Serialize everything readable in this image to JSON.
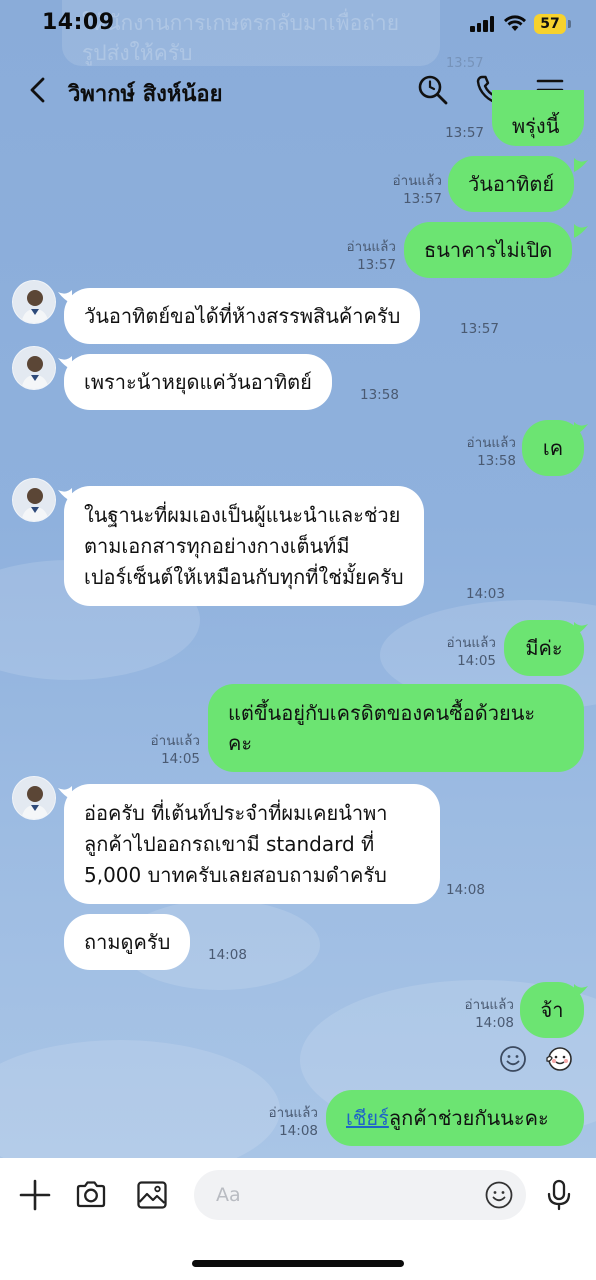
{
  "status_bar": {
    "time": "14:09",
    "battery": "57"
  },
  "header": {
    "contact_name": "วิพากษ์ สิงห์น้อย"
  },
  "ghost_message": {
    "text": "ให้นักงานการเกษตรกลับมาเพื่อถ่ายรูปส่งให้ครับ",
    "time": "13:57"
  },
  "messages": [
    {
      "side": "out",
      "text": "พรุ่งนี้",
      "read": "",
      "time": "13:57"
    },
    {
      "side": "out",
      "text": "วันอาทิตย์",
      "read": "อ่านแล้ว",
      "time": "13:57"
    },
    {
      "side": "out",
      "text": "ธนาคารไม่เปิด",
      "read": "อ่านแล้ว",
      "time": "13:57"
    },
    {
      "side": "in",
      "text": "วันอาทิตย์ขอได้ที่ห้างสรรพสินค้าครับ",
      "time": "13:57"
    },
    {
      "side": "in",
      "text": "เพราะน้าหยุดแค่วันอาทิตย์",
      "time": "13:58"
    },
    {
      "side": "out",
      "text": "เค",
      "read": "อ่านแล้ว",
      "time": "13:58"
    },
    {
      "side": "in",
      "lines": [
        "ในฐานะที่ผมเองเป็นผู้แนะนำและช่วย",
        "ตามเอกสารทุกอย่างกางเต็นท์มี",
        "เปอร์เซ็นต์ให้เหมือนกับทุกที่ใช่มั้ยครับ"
      ],
      "time": "14:03"
    },
    {
      "side": "out",
      "text": "มีค่ะ",
      "read": "อ่านแล้ว",
      "time": "14:05"
    },
    {
      "side": "out",
      "lines": [
        "แต่ขึ้นอยู่กับเครดิตของคนซื้อด้วยนะ",
        "คะ"
      ],
      "read": "อ่านแล้ว",
      "time": "14:05"
    },
    {
      "side": "in",
      "lines": [
        "อ่อครับ ที่เต้นท์ประจำที่ผมเคยนำพา",
        "ลูกค้าไปออกรถเขามี standard ที่",
        "5,000 บาทครับเลยสอบถามดำครับ"
      ],
      "time": "14:08"
    },
    {
      "side": "in",
      "text": "ถามดูครับ",
      "time": "14:08"
    },
    {
      "side": "out",
      "text": "จ้า",
      "read": "อ่านแล้ว",
      "time": "14:08"
    },
    {
      "side": "out",
      "link": "เชียร์",
      "rest": "ลูกค้าช่วยกันนะคะ",
      "read": "อ่านแล้ว",
      "time": "14:08"
    }
  ],
  "reactions": [
    {
      "icon": "smiley-reaction-icon"
    },
    {
      "icon": "cheek-pinch-sticker-icon"
    }
  ],
  "input": {
    "placeholder": "Aa"
  },
  "icons": {
    "back": "chevron-left-icon",
    "search": "search-icon",
    "call": "phone-icon",
    "menu": "menu-icon",
    "add": "plus-icon",
    "camera": "camera-icon",
    "gallery": "image-icon",
    "emoji": "emoji-icon",
    "mic": "microphone-icon"
  },
  "colors": {
    "outgoing_bubble": "#6ce472",
    "incoming_bubble": "#ffffff",
    "chat_background": "#8fb0dc",
    "link": "#1f64c8"
  }
}
